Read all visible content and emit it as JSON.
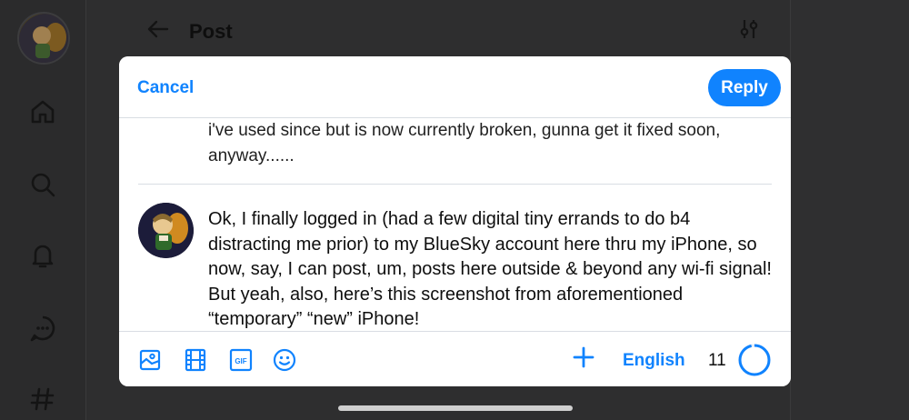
{
  "header": {
    "title": "Post"
  },
  "modal": {
    "cancel_label": "Cancel",
    "reply_label": "Reply",
    "quoted_lines": [
      "i've used since but is now currently broken, gunna get it fixed soon,",
      "anyway......"
    ],
    "composer_text": "Ok, I finally logged in (had a few digital tiny errands to do b4 distracting me prior) to my BlueSky account here thru my iPhone, so now, say, I can post, um, posts here outside & beyond any wi-fi signal! But yeah, also, here’s this screenshot from aforementioned “temporary” “new” iPhone!",
    "toolbar": {
      "language": "English",
      "char_count": "11",
      "gif_label": "GIF"
    }
  },
  "icons": {
    "rail": [
      "home-icon",
      "search-icon",
      "bell-icon",
      "chat-icon",
      "hashtag-icon"
    ],
    "toolbar": [
      "image-icon",
      "video-icon",
      "gif-icon",
      "emoji-icon",
      "plus-icon"
    ]
  },
  "colors": {
    "accent": "#1083fe",
    "backdrop": "#2f2f30",
    "text": "#0e0e0e"
  }
}
